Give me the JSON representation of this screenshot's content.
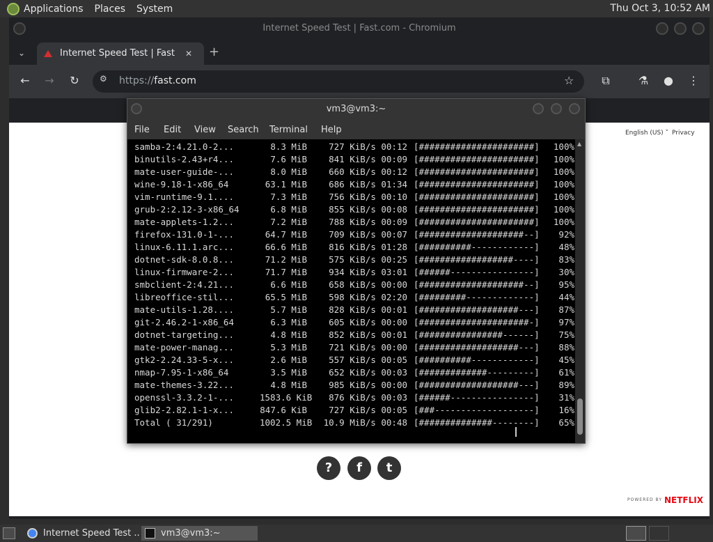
{
  "top_panel": {
    "menus": [
      "Applications",
      "Places",
      "System"
    ],
    "clock": "Thu Oct  3, 10:52 AM"
  },
  "chromium": {
    "window_title": "Internet Speed Test | Fast.com - Chromium",
    "tab_title": "Internet Speed Test | Fast.com",
    "tab_close": "✕",
    "new_tab": "+",
    "url_scheme": "https://",
    "url_host": "fast.com"
  },
  "page": {
    "language": "English (US)",
    "privacy": "Privacy",
    "social": [
      "?",
      "f",
      "t"
    ],
    "powered_by": "POWERED BY",
    "netflix": "NETFLIX"
  },
  "terminal": {
    "title": "vm3@vm3:~",
    "menus": [
      "File",
      "Edit",
      "View",
      "Search",
      "Terminal",
      "Help"
    ],
    "rows": [
      {
        "name": "samba-2:4.21.0-2...",
        "size": "8.3 MiB",
        "rate": "727 KiB/s 00:12",
        "bar": "[######################]",
        "pct": "100%"
      },
      {
        "name": "binutils-2.43+r4...",
        "size": "7.6 MiB",
        "rate": "841 KiB/s 00:09",
        "bar": "[######################]",
        "pct": "100%"
      },
      {
        "name": "mate-user-guide-...",
        "size": "8.0 MiB",
        "rate": "660 KiB/s 00:12",
        "bar": "[######################]",
        "pct": "100%"
      },
      {
        "name": "wine-9.18-1-x86_64",
        "size": "63.1 MiB",
        "rate": "686 KiB/s 01:34",
        "bar": "[######################]",
        "pct": "100%"
      },
      {
        "name": "vim-runtime-9.1....",
        "size": "7.3 MiB",
        "rate": "756 KiB/s 00:10",
        "bar": "[######################]",
        "pct": "100%"
      },
      {
        "name": "grub-2:2.12-3-x86_64",
        "size": "6.8 MiB",
        "rate": "855 KiB/s 00:08",
        "bar": "[######################]",
        "pct": "100%"
      },
      {
        "name": "mate-applets-1.2...",
        "size": "7.2 MiB",
        "rate": "788 KiB/s 00:09",
        "bar": "[######################]",
        "pct": "100%"
      },
      {
        "name": "firefox-131.0-1-...",
        "size": "64.7 MiB",
        "rate": "709 KiB/s 00:07",
        "bar": "[####################--]",
        "pct": "92%"
      },
      {
        "name": "linux-6.11.1.arc...",
        "size": "66.6 MiB",
        "rate": "816 KiB/s 01:28",
        "bar": "[##########------------]",
        "pct": "48%"
      },
      {
        "name": "dotnet-sdk-8.0.8...",
        "size": "71.2 MiB",
        "rate": "575 KiB/s 00:25",
        "bar": "[##################----]",
        "pct": "83%"
      },
      {
        "name": "linux-firmware-2...",
        "size": "71.7 MiB",
        "rate": "934 KiB/s 03:01",
        "bar": "[######----------------]",
        "pct": "30%"
      },
      {
        "name": "smbclient-2:4.21...",
        "size": "6.6 MiB",
        "rate": "658 KiB/s 00:00",
        "bar": "[####################--]",
        "pct": "95%"
      },
      {
        "name": "libreoffice-stil...",
        "size": "65.5 MiB",
        "rate": "598 KiB/s 02:20",
        "bar": "[#########-------------]",
        "pct": "44%"
      },
      {
        "name": "mate-utils-1.28....",
        "size": "5.7 MiB",
        "rate": "828 KiB/s 00:01",
        "bar": "[###################---]",
        "pct": "87%"
      },
      {
        "name": "git-2.46.2-1-x86_64",
        "size": "6.3 MiB",
        "rate": "605 KiB/s 00:00",
        "bar": "[#####################-]",
        "pct": "97%"
      },
      {
        "name": "dotnet-targeting...",
        "size": "4.8 MiB",
        "rate": "852 KiB/s 00:01",
        "bar": "[################------]",
        "pct": "75%"
      },
      {
        "name": "mate-power-manag...",
        "size": "5.3 MiB",
        "rate": "721 KiB/s 00:00",
        "bar": "[###################---]",
        "pct": "88%"
      },
      {
        "name": "gtk2-2.24.33-5-x...",
        "size": "2.6 MiB",
        "rate": "557 KiB/s 00:05",
        "bar": "[##########------------]",
        "pct": "45%"
      },
      {
        "name": "nmap-7.95-1-x86_64",
        "size": "3.5 MiB",
        "rate": "652 KiB/s 00:03",
        "bar": "[#############---------]",
        "pct": "61%"
      },
      {
        "name": "mate-themes-3.22...",
        "size": "4.8 MiB",
        "rate": "985 KiB/s 00:00",
        "bar": "[###################---]",
        "pct": "89%"
      },
      {
        "name": "openssl-3.3.2-1-...",
        "size": "1583.6 KiB",
        "rate": "876 KiB/s 00:03",
        "bar": "[######----------------]",
        "pct": "31%"
      },
      {
        "name": "glib2-2.82.1-1-x...",
        "size": "847.6 KiB",
        "rate": "727 KiB/s 00:05",
        "bar": "[###-------------------]",
        "pct": "16%"
      },
      {
        "name": "Total ( 31/291)",
        "size": "1002.5 MiB",
        "rate": "10.9 MiB/s 00:48",
        "bar": "[##############--------]",
        "pct": "65%"
      }
    ]
  },
  "taskbar": {
    "tasks": [
      "Internet Speed Test ...",
      "vm3@vm3:~"
    ]
  }
}
